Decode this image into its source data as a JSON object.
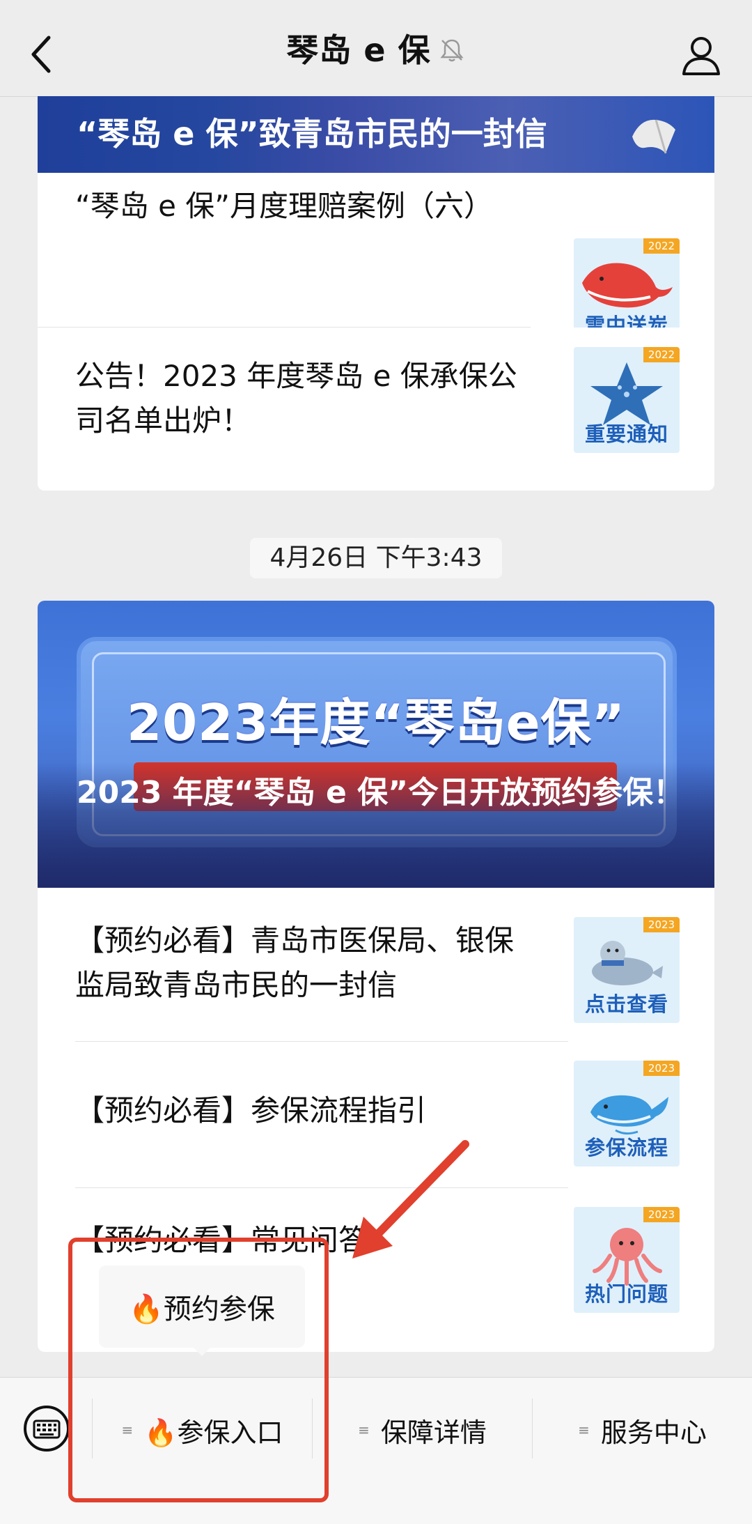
{
  "header": {
    "title": "琴岛 e 保"
  },
  "block1": {
    "banner_title": "“琴岛 e 保”致青岛市民的一封信",
    "items": [
      {
        "text": "“琴岛 e 保”月度理赔案例（六）",
        "thumb_caption": "雪中送炭",
        "thumb_year": "2022"
      },
      {
        "text": "公告！2023 年度琴岛 e 保承保公司名单出炉！",
        "thumb_caption": "重要通知",
        "thumb_year": "2022"
      }
    ]
  },
  "timestamp": "4月26日 下午3:43",
  "block2": {
    "banner_big": "2023年度“琴岛e保”",
    "banner_title": "2023 年度“琴岛 e 保”今日开放预约参保！",
    "items": [
      {
        "text": "【预约必看】青岛市医保局、银保监局致青岛市民的一封信",
        "thumb_caption": "点击查看",
        "thumb_year": "2023"
      },
      {
        "text": "【预约必看】参保流程指引",
        "thumb_caption": "参保流程",
        "thumb_year": "2023"
      },
      {
        "text": "【预约必看】常见问答",
        "thumb_caption": "热门问题",
        "thumb_year": "2023"
      }
    ]
  },
  "popup": {
    "label": "🔥预约参保"
  },
  "menu": {
    "items": [
      {
        "label": "🔥参保入口"
      },
      {
        "label": "保障详情"
      },
      {
        "label": "服务中心"
      }
    ],
    "lines_glyph": "≡"
  },
  "colors": {
    "highlight_red": "#e0402d",
    "thumb_caption": "#1e5fb9"
  }
}
